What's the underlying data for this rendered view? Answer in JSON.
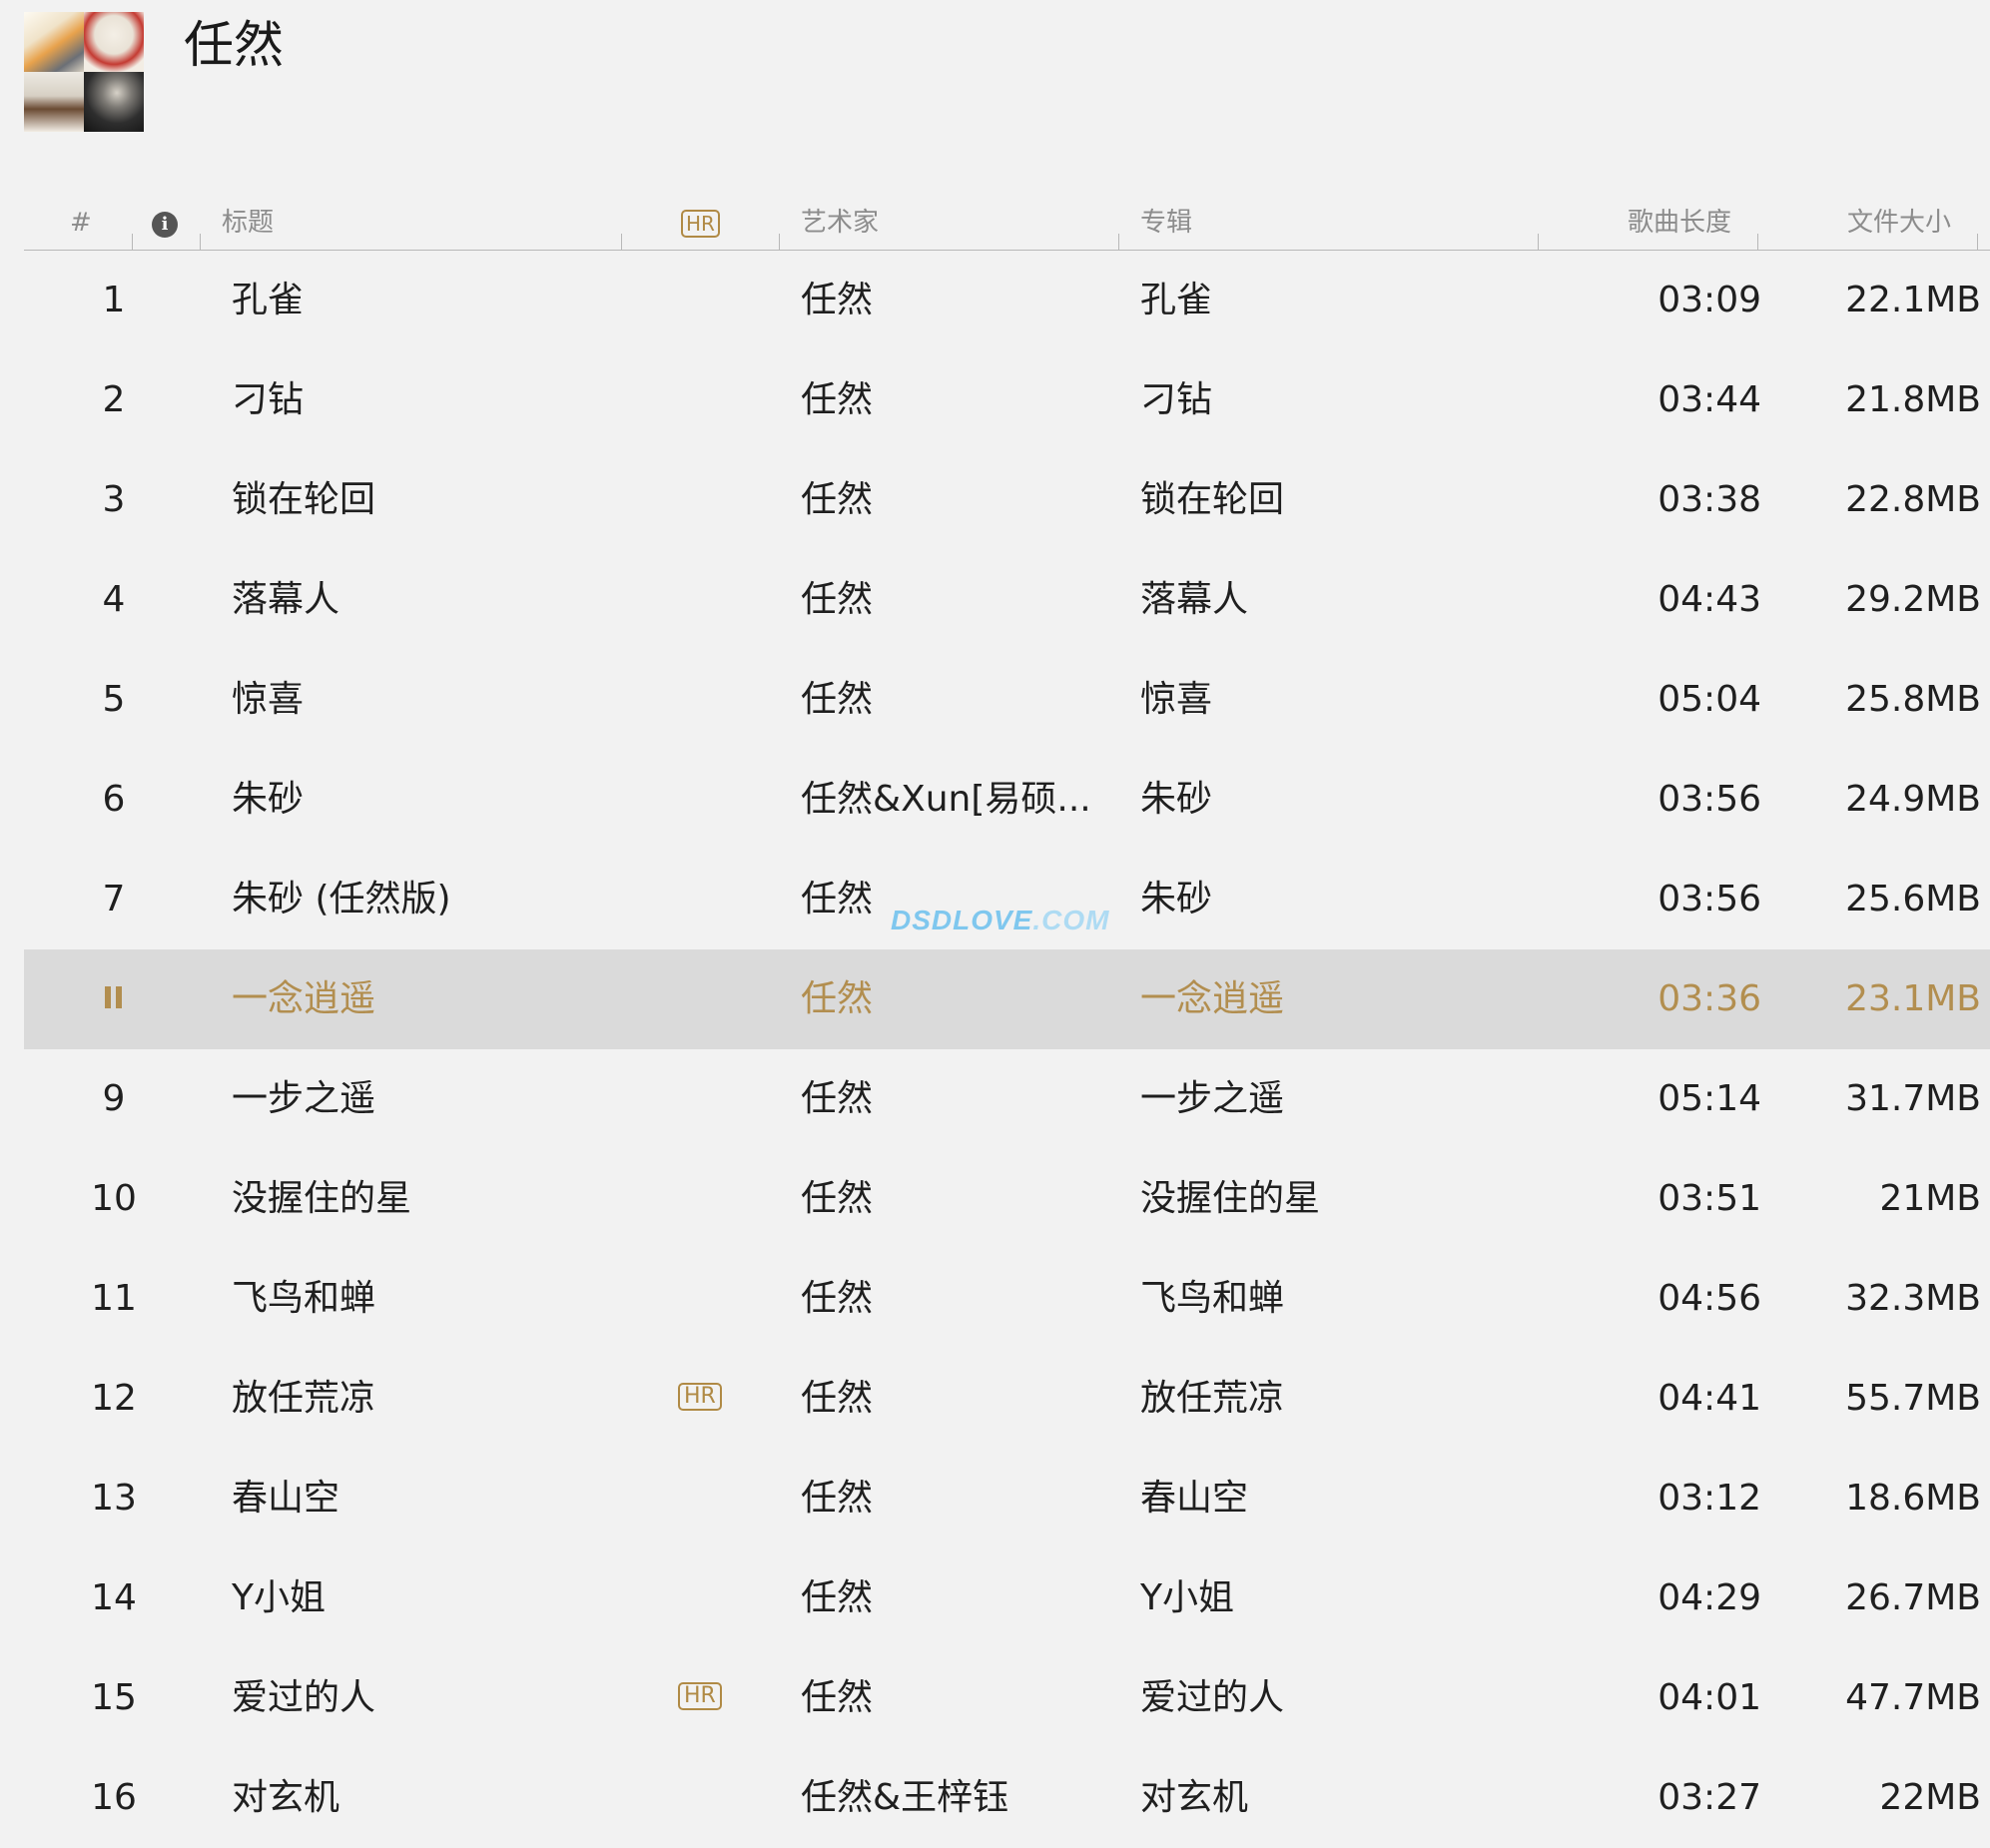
{
  "header": {
    "album_title": "任然"
  },
  "columns": {
    "num": "#",
    "title": "标题",
    "hr": "HR",
    "artist": "艺术家",
    "album": "专辑",
    "duration": "歌曲长度",
    "size": "文件大小"
  },
  "tracks": [
    {
      "num": "1",
      "title": "孔雀",
      "hr": "",
      "artist": "任然",
      "album": "孔雀",
      "duration": "03:09",
      "size": "22.1MB"
    },
    {
      "num": "2",
      "title": "刁钻",
      "hr": "",
      "artist": "任然",
      "album": "刁钻",
      "duration": "03:44",
      "size": "21.8MB"
    },
    {
      "num": "3",
      "title": "锁在轮回",
      "hr": "",
      "artist": "任然",
      "album": "锁在轮回",
      "duration": "03:38",
      "size": "22.8MB"
    },
    {
      "num": "4",
      "title": "落幕人",
      "hr": "",
      "artist": "任然",
      "album": "落幕人",
      "duration": "04:43",
      "size": "29.2MB"
    },
    {
      "num": "5",
      "title": "惊喜",
      "hr": "",
      "artist": "任然",
      "album": "惊喜",
      "duration": "05:04",
      "size": "25.8MB"
    },
    {
      "num": "6",
      "title": "朱砂",
      "hr": "",
      "artist": "任然&Xun[易硕...",
      "album": "朱砂",
      "duration": "03:56",
      "size": "24.9MB"
    },
    {
      "num": "7",
      "title": "朱砂 (任然版)",
      "hr": "",
      "artist": "任然",
      "album": "朱砂",
      "duration": "03:56",
      "size": "25.6MB"
    },
    {
      "num": "",
      "title": "一念逍遥",
      "hr": "",
      "artist": "任然",
      "album": "一念逍遥",
      "duration": "03:36",
      "size": "23.1MB",
      "playing": true
    },
    {
      "num": "9",
      "title": "一步之遥",
      "hr": "",
      "artist": "任然",
      "album": "一步之遥",
      "duration": "05:14",
      "size": "31.7MB"
    },
    {
      "num": "10",
      "title": "没握住的星",
      "hr": "",
      "artist": "任然",
      "album": "没握住的星",
      "duration": "03:51",
      "size": "21MB"
    },
    {
      "num": "11",
      "title": "飞鸟和蝉",
      "hr": "",
      "artist": "任然",
      "album": "飞鸟和蝉",
      "duration": "04:56",
      "size": "32.3MB"
    },
    {
      "num": "12",
      "title": "放任荒凉",
      "hr": "HR",
      "artist": "任然",
      "album": "放任荒凉",
      "duration": "04:41",
      "size": "55.7MB"
    },
    {
      "num": "13",
      "title": "春山空",
      "hr": "",
      "artist": "任然",
      "album": "春山空",
      "duration": "03:12",
      "size": "18.6MB"
    },
    {
      "num": "14",
      "title": "Y小姐",
      "hr": "",
      "artist": "任然",
      "album": "Y小姐",
      "duration": "04:29",
      "size": "26.7MB"
    },
    {
      "num": "15",
      "title": "爱过的人",
      "hr": "HR",
      "artist": "任然",
      "album": "爱过的人",
      "duration": "04:01",
      "size": "47.7MB"
    },
    {
      "num": "16",
      "title": "对玄机",
      "hr": "",
      "artist": "任然&王梓钰",
      "album": "对玄机",
      "duration": "03:27",
      "size": "22MB"
    }
  ],
  "watermark": {
    "main": "DSDLOVE",
    "suffix": ".COM"
  },
  "colors": {
    "accent": "#b28e4f",
    "playing_row_bg": "#dadada",
    "background": "#f2f2f2"
  }
}
